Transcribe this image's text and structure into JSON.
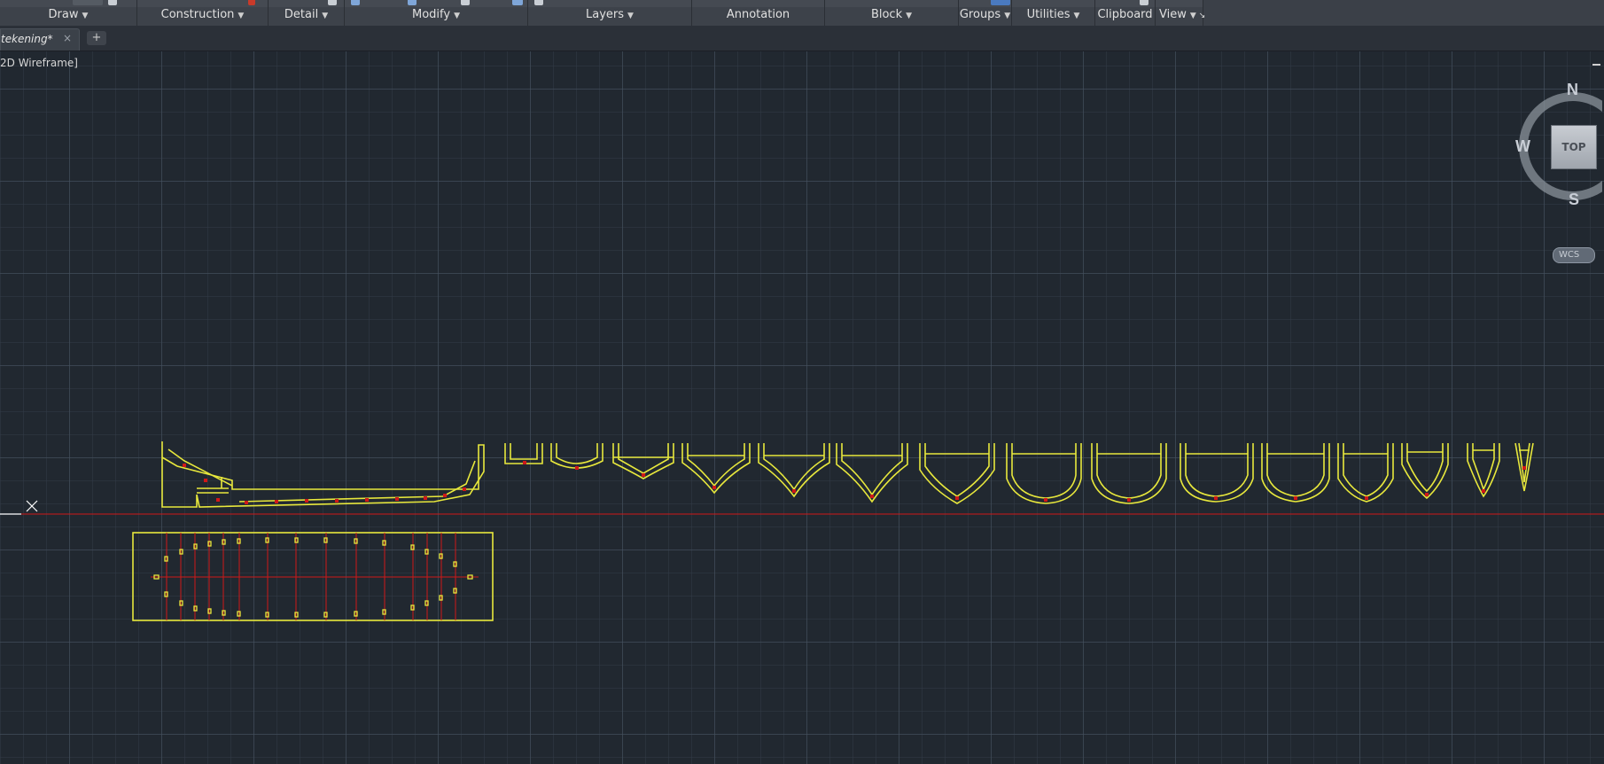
{
  "ribbon": {
    "panels": [
      {
        "id": "draw",
        "label": "Draw",
        "has_menu": true
      },
      {
        "id": "construction",
        "label": "Construction",
        "has_menu": true
      },
      {
        "id": "detail",
        "label": "Detail",
        "has_menu": true
      },
      {
        "id": "modify",
        "label": "Modify",
        "has_menu": true
      },
      {
        "id": "layers",
        "label": "Layers",
        "has_menu": true
      },
      {
        "id": "annotation",
        "label": "Annotation",
        "has_menu": false
      },
      {
        "id": "block",
        "label": "Block",
        "has_menu": true
      },
      {
        "id": "groups",
        "label": "Groups",
        "has_menu": true
      },
      {
        "id": "utilities",
        "label": "Utilities",
        "has_menu": true
      },
      {
        "id": "clipboard",
        "label": "Clipboard",
        "has_menu": false
      },
      {
        "id": "view",
        "label": "View",
        "has_menu": true
      }
    ]
  },
  "tabs": {
    "document": "tekening*",
    "close_glyph": "×",
    "new_tab_glyph": "+"
  },
  "viewport": {
    "label": "2D Wireframe]"
  },
  "viewcube": {
    "north": "N",
    "south": "S",
    "west": "W",
    "face": "TOP",
    "ucs": "WCS"
  },
  "colors": {
    "background": "#212830",
    "geometry": "#e8e83c",
    "construction": "#e02020",
    "ribbon": "#3d424a"
  },
  "icons": {
    "minimize": "minimize-icon",
    "expand": "expand-icon"
  }
}
